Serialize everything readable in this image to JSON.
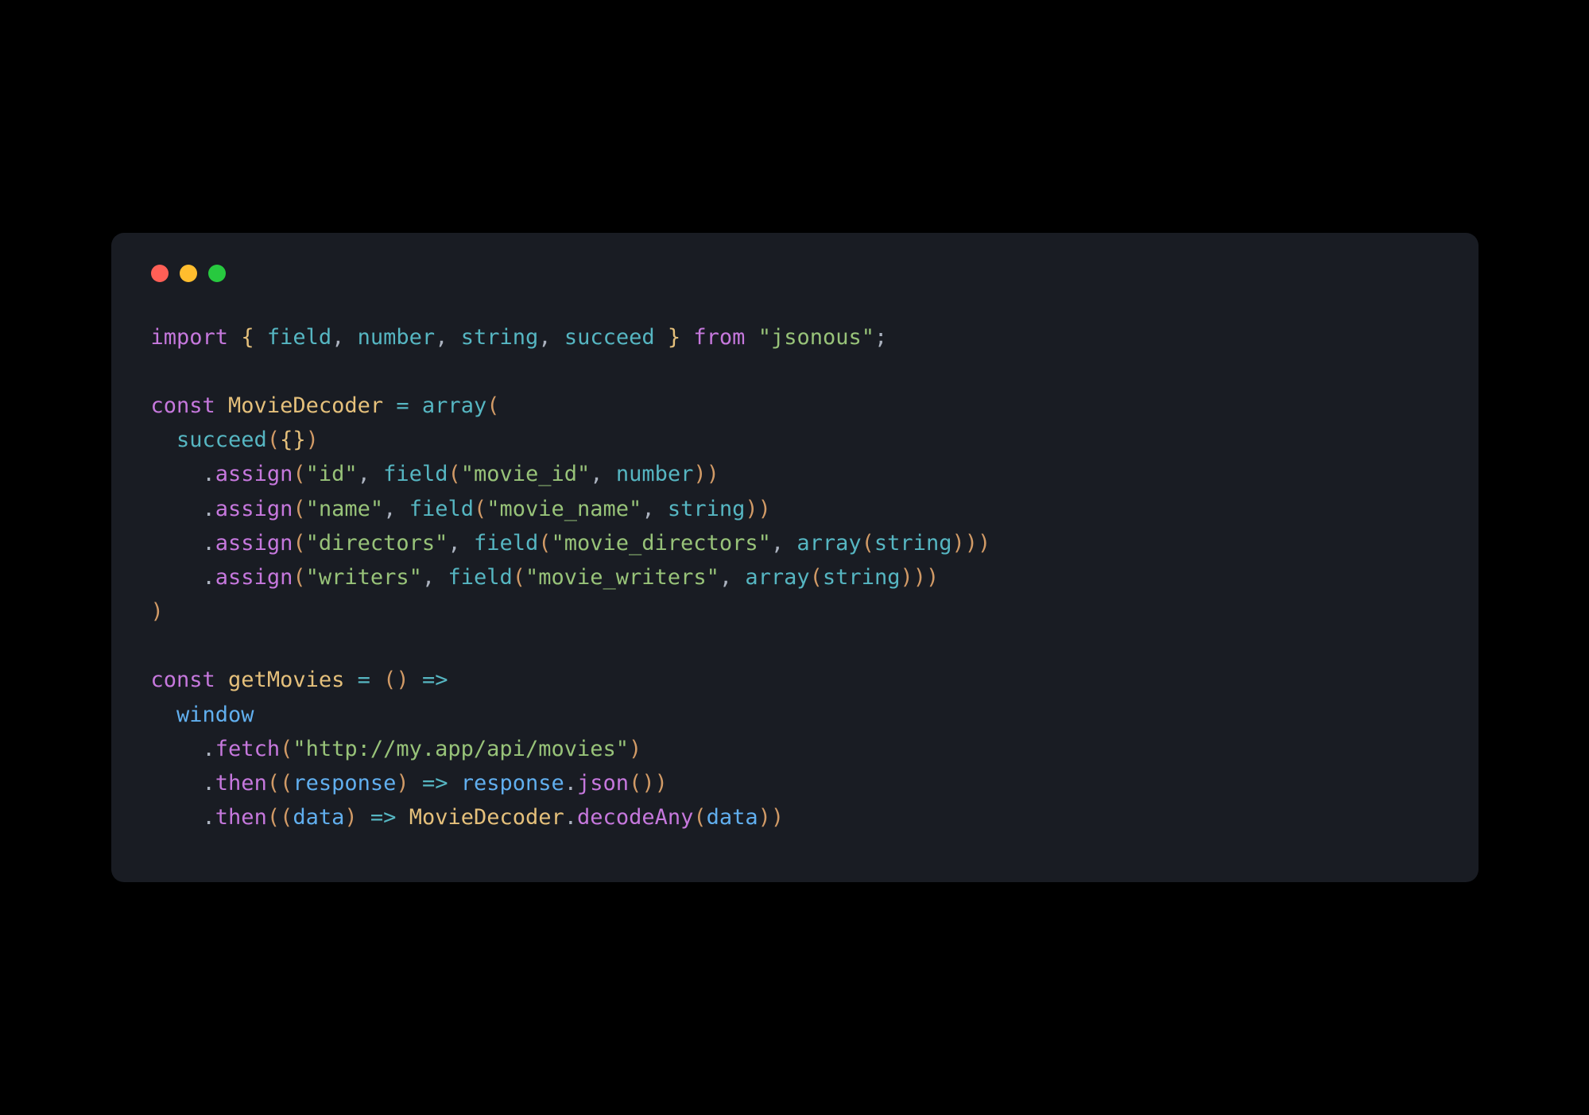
{
  "tokens": {
    "import": "import",
    "lbrace": "{",
    "rbrace": "}",
    "field": "field",
    "number": "number",
    "string": "string",
    "succeed": "succeed",
    "from": "from",
    "jsonous": "\"jsonous\"",
    "semi": ";",
    "const": "const",
    "MovieDecoder": "MovieDecoder",
    "eq": "=",
    "array": "array",
    "lparen": "(",
    "rparen": ")",
    "empty_obj": "{}",
    "dot": ".",
    "assign": "assign",
    "id": "\"id\"",
    "movie_id": "\"movie_id\"",
    "name": "\"name\"",
    "movie_name": "\"movie_name\"",
    "directors": "\"directors\"",
    "movie_directors": "\"movie_directors\"",
    "writers": "\"writers\"",
    "movie_writers": "\"movie_writers\"",
    "getMovies": "getMovies",
    "arrow": "=>",
    "window": "window",
    "fetch": "fetch",
    "url": "\"http://my.app/api/movies\"",
    "then": "then",
    "response": "response",
    "json": "json",
    "data": "data",
    "decodeAny": "decodeAny",
    "comma": ","
  }
}
